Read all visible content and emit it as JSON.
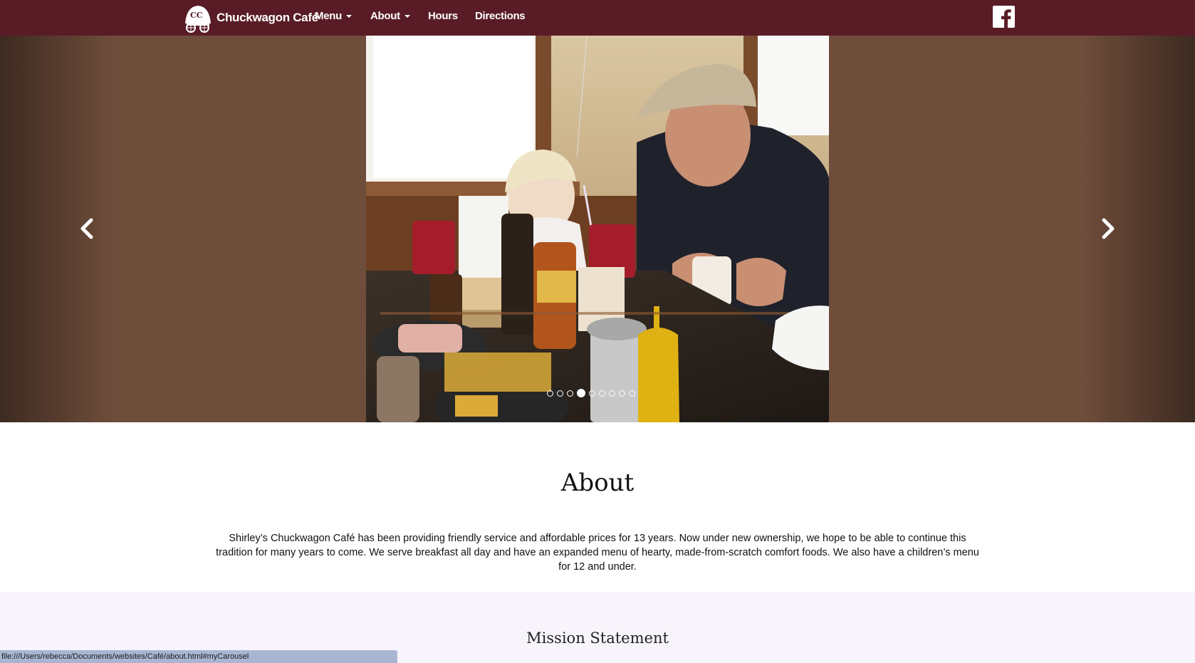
{
  "navbar": {
    "brand_logo_text": "CC",
    "brand_name": "Chuckwagon Café",
    "items": [
      {
        "label": "Menu",
        "has_dropdown": true
      },
      {
        "label": "About",
        "has_dropdown": true
      },
      {
        "label": "Hours",
        "has_dropdown": false
      },
      {
        "label": "Directions",
        "has_dropdown": false
      }
    ],
    "social_icon": "facebook-icon"
  },
  "carousel": {
    "prev_icon": "chevron-left-icon",
    "next_icon": "chevron-right-icon",
    "slide_count": 9,
    "active_index": 3
  },
  "about": {
    "title": "About",
    "text": "Shirley’s Chuckwagon Café has been providing friendly service and affordable prices for 13 years. Now under new ownership, we hope to be able to continue this tradition for many years to come. We serve breakfast all day and have an expanded menu of hearty, made-from-scratch comfort foods. We also have a children’s menu for 12 and under."
  },
  "mission": {
    "title": "Mission Statement"
  },
  "statusbar": {
    "url": "file:///Users/rebecca/Documents/websites/Café/about.html#myCarousel"
  },
  "colors": {
    "navbar": "#591c26",
    "carousel_bg": "#6f4d3b",
    "mission_bg": "#f8f4fc",
    "statusbar": "#a9b6d2"
  }
}
